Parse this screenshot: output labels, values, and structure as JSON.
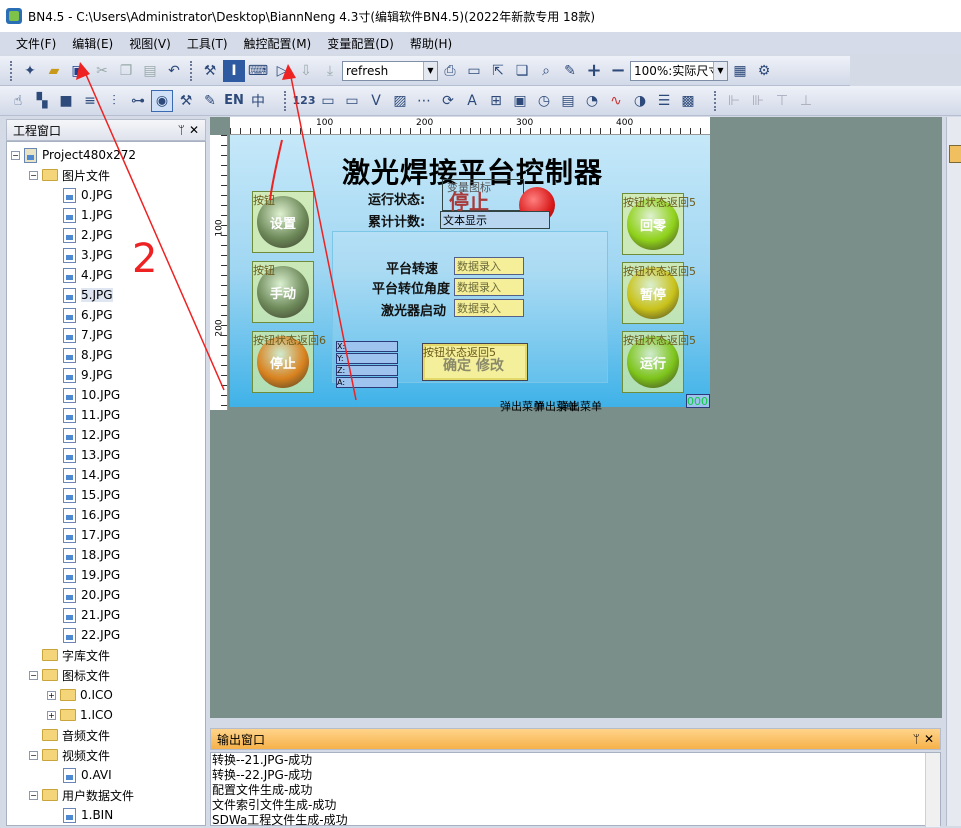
{
  "window": {
    "title": "BN4.5 - C:\\Users\\Administrator\\Desktop\\BiannNeng 4.3寸(编辑软件BN4.5)(2022年新款专用 18款)"
  },
  "menu": [
    "文件(F)",
    "编辑(E)",
    "视图(V)",
    "工具(T)",
    "触控配置(M)",
    "变量配置(D)",
    "帮助(H)"
  ],
  "toolbar": {
    "page_combo": "refresh",
    "zoom_combo": "100%:实际尺寸"
  },
  "toolbar2": {
    "en_label": "EN",
    "num_label": "123"
  },
  "project_panel": {
    "title": "工程窗口",
    "root": "Project480x272",
    "image_folder": "图片文件",
    "images": [
      "0.JPG",
      "1.JPG",
      "2.JPG",
      "3.JPG",
      "4.JPG",
      "5.JPG",
      "6.JPG",
      "7.JPG",
      "8.JPG",
      "9.JPG",
      "10.JPG",
      "11.JPG",
      "12.JPG",
      "13.JPG",
      "14.JPG",
      "15.JPG",
      "16.JPG",
      "17.JPG",
      "18.JPG",
      "19.JPG",
      "20.JPG",
      "21.JPG",
      "22.JPG"
    ],
    "font_folder": "字库文件",
    "icon_folder": "图标文件",
    "icons": [
      "0.ICO",
      "1.ICO"
    ],
    "audio_folder": "音频文件",
    "video_folder": "视频文件",
    "videos": [
      "0.AVI"
    ],
    "userdata_folder": "用户数据文件",
    "userdata": [
      "1.BIN"
    ]
  },
  "ruler": {
    "h_ticks": [
      "100",
      "200",
      "300",
      "400"
    ],
    "v_ticks": [
      "100",
      "200"
    ]
  },
  "hmi": {
    "title": "激光焊接平台控制器",
    "run_status_label": "运行状态:",
    "run_status_value": "停止",
    "var_icon_label": "变量图标",
    "count_label": "累计计数:",
    "text_display": "文本显示",
    "left_buttons": [
      {
        "caption": "按钮",
        "text": "设置",
        "color": "#6e8a5a"
      },
      {
        "caption": "按钮",
        "text": "手动",
        "color": "#6e8a5a"
      },
      {
        "caption": "按钮状态返回6",
        "text": "停止",
        "color": "#d9821f"
      }
    ],
    "right_buttons": [
      {
        "caption": "按钮状态返回5",
        "text": "回零",
        "color": "#8fd11a"
      },
      {
        "caption": "按钮状态返回5",
        "text": "暂停",
        "color": "#c9c21a"
      },
      {
        "caption": "按钮状态返回5",
        "text": "运行",
        "color": "#7dc41a"
      }
    ],
    "params": [
      {
        "label": "平台转速",
        "value": "数据录入"
      },
      {
        "label": "平台转位角度",
        "value": "数据录入"
      },
      {
        "label": "激光器启动",
        "value": "数据录入"
      }
    ],
    "coords": [
      "X:",
      "Y:",
      "Z:",
      "A:"
    ],
    "confirm_caption": "按钮状态返回5",
    "confirm_text": "确定 修改",
    "popup_menu": "弹出菜单",
    "corner_value": "000"
  },
  "annotations": {
    "mark1": "/",
    "mark2": "2"
  },
  "output": {
    "title": "输出窗口",
    "lines": [
      "转换--21.JPG-成功",
      "转换--22.JPG-成功",
      "配置文件生成-成功",
      "文件索引文件生成-成功",
      "SDWa工程文件生成-成功"
    ]
  }
}
